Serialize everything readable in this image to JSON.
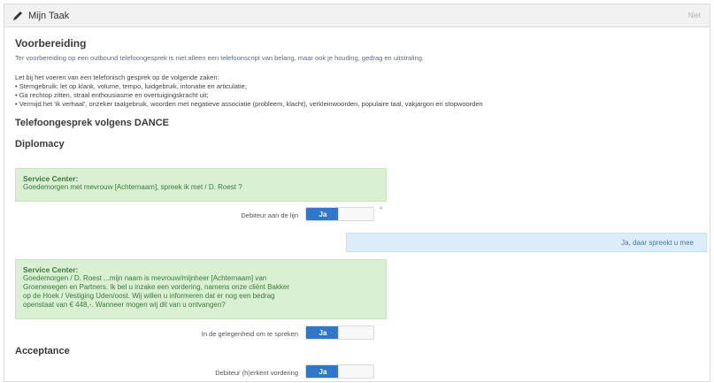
{
  "header": {
    "title": "Mijn Taak",
    "tool_label": "Niet"
  },
  "section_preparation": {
    "heading": "Voorbereiding",
    "intro": "Ter voorbereiding op een outbound telefoongesprek is niet alleen een telefoonscript van belang, maar ook je houding, gedrag en uitstraling.",
    "list_title": "Let bij het voeren van een telefonisch gesprek op de volgende zaken:",
    "bullets": [
      "• Stemgebruik: let op klank, volume, tempo, luidgebruik, intonatie en articulatie;",
      "• Ga rechtop zitten, straal enthousiasme en overtuigingskracht uit;",
      "• Vermijd het 'ik verhaal', onzeker taalgebruik, woorden met negatieve associatie (probleem, klacht), verkleinwoorden, populaire taal, vakjargon en stopwoorden"
    ]
  },
  "dance_heading": "Telefoongesprek volgens DANCE",
  "diplomacy": {
    "heading": "Diplomacy",
    "box1_title": "Service Center:",
    "box1_text": "Goedemorgen met mevrouw [Achternaam], spreek ik met / D. Roest ?",
    "row1_label": "Debiteur aan de lijn",
    "row1_toggle": "Ja",
    "asterisk": "*",
    "reply": "Ja, daar spreekt u mee",
    "box2_title": "Service Center:",
    "box2_lines": [
      "Goedemorgen / D. Roest ...mijn naam is mevrouw/mijnheer [Achternaam] van",
      "Groenewegen en Partners. Ik bel u inzake een vordering, namens onze cliënt Bakker",
      "op de Hoek / Vestiging Uden/oost. Wij willen u informeren dat er nog een bedrag",
      "openstaat van € 448,-. Wanneer mogen wij dit van u ontvangen?"
    ],
    "row2_label": "In de gelegenheid om te spreken",
    "row2_toggle": "Ja"
  },
  "acceptance": {
    "heading": "Acceptance",
    "row3_label": "Debiteur (h)erkent vordering",
    "row3_toggle": "Ja"
  }
}
